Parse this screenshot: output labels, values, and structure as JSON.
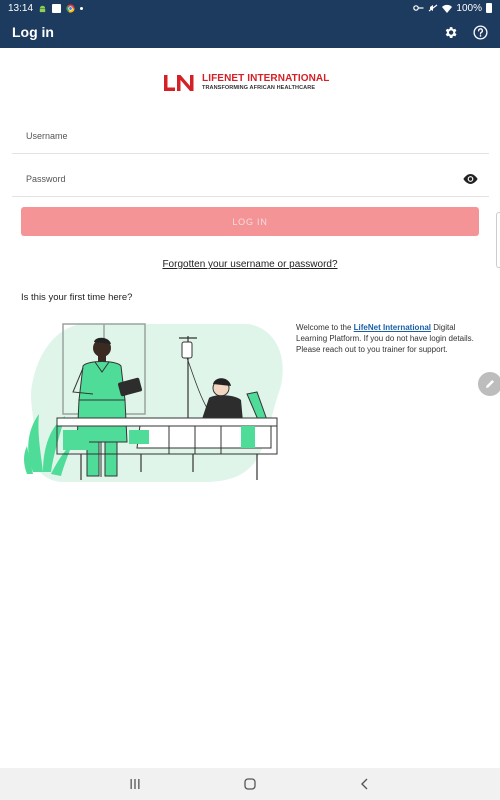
{
  "status_bar": {
    "time": "13:14",
    "battery": "100%"
  },
  "app_bar": {
    "title": "Log in",
    "icons": [
      "gear-icon",
      "help-icon"
    ]
  },
  "logo": {
    "name": "LIFENET INTERNATIONAL",
    "tagline": "TRANSFORMING AFRICAN HEALTHCARE"
  },
  "form": {
    "username_placeholder": "Username",
    "password_placeholder": "Password",
    "login_label": "LOG IN",
    "forgot_label": "Forgotten your username or password?"
  },
  "first_time": {
    "heading": "Is this your first time here?",
    "welcome_pre": "Welcome to the ",
    "welcome_link": "LifeNet International",
    "welcome_post": " Digital Learning Platform. If you do not have login details. Please reach out to you trainer for support."
  },
  "colors": {
    "app_bar": "#1d3a5f",
    "login_button": "#f59496",
    "brand_red": "#d42027",
    "link_blue": "#1a5fa8",
    "illustration_green": "#4fdc98"
  }
}
